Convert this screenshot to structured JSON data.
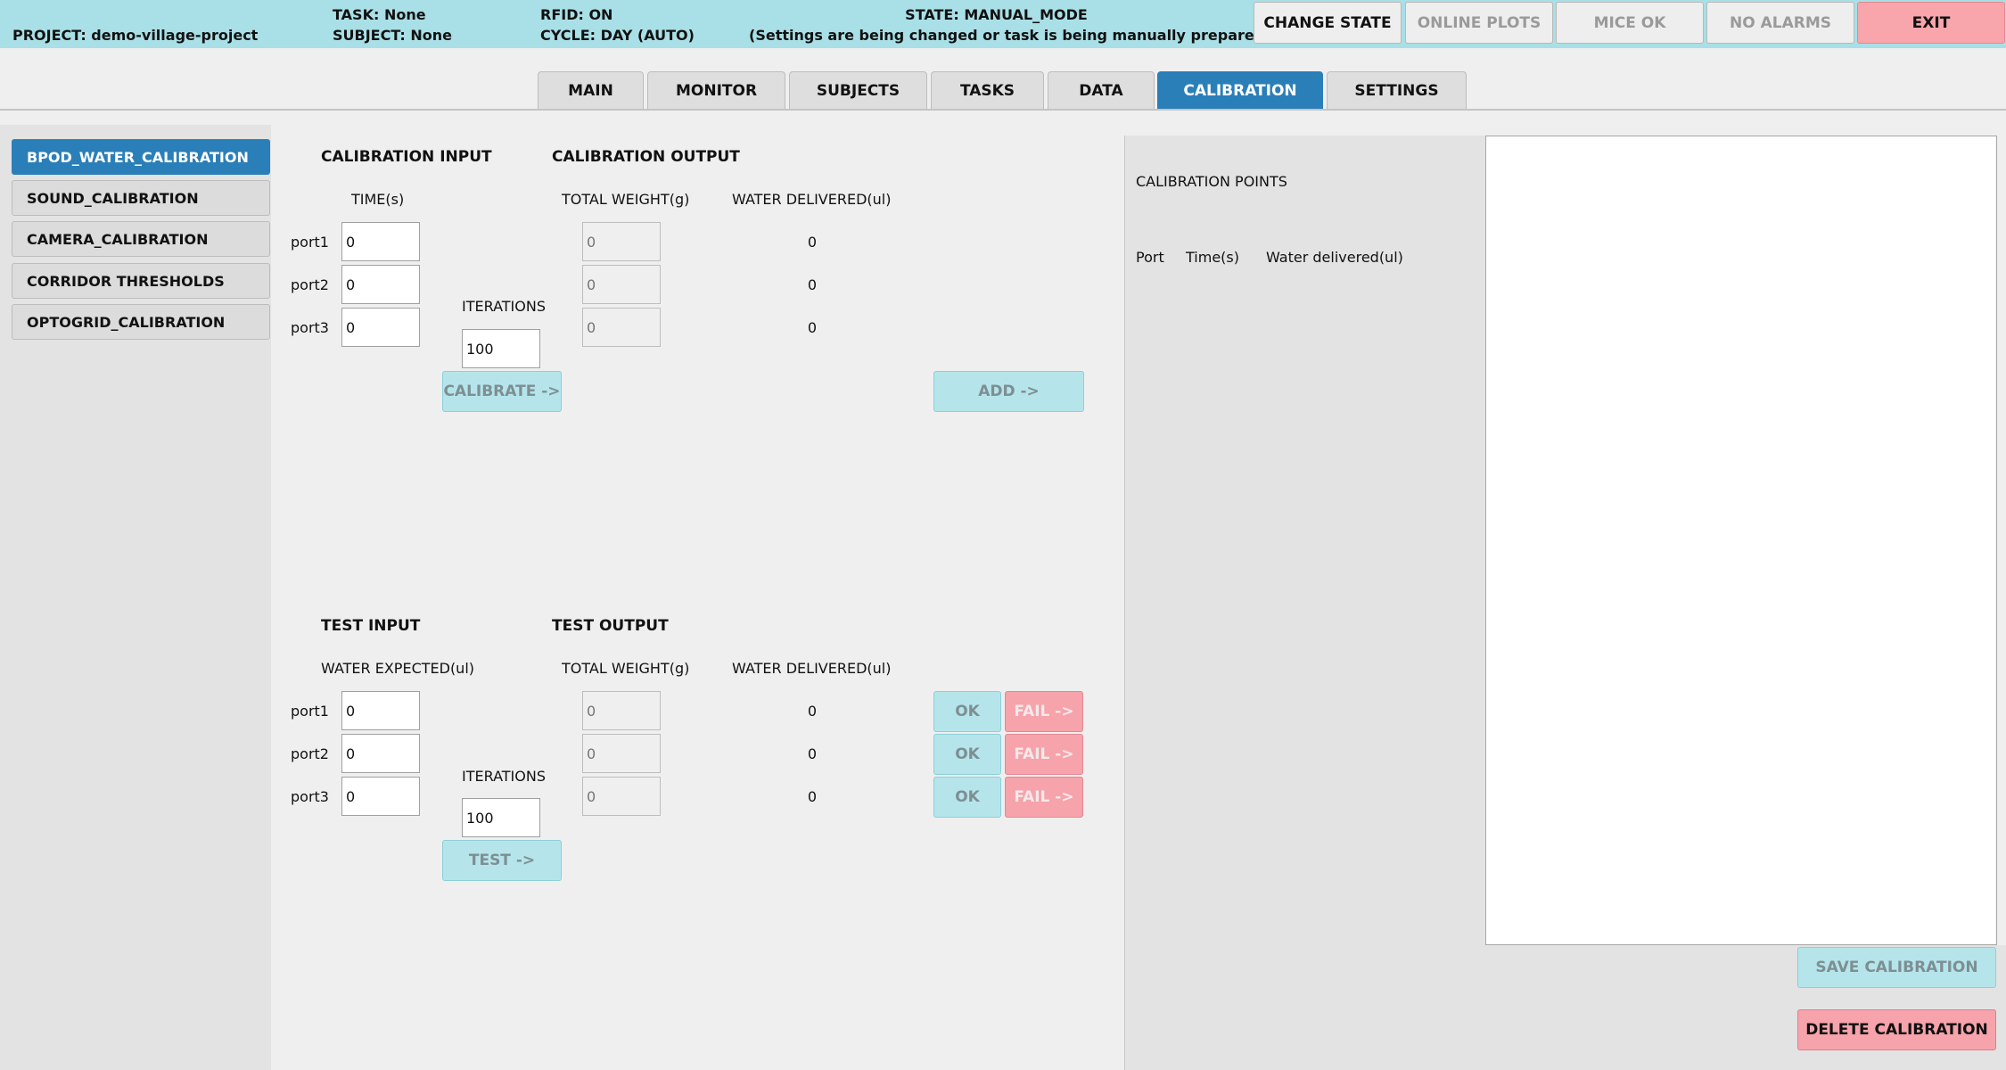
{
  "status": {
    "project": "PROJECT: demo-village-project",
    "task": "TASK: None",
    "subject": "SUBJECT: None",
    "rfid": "RFID: ON",
    "cycle": "CYCLE: DAY (AUTO)",
    "state": "STATE: MANUAL_MODE",
    "state_note": "(Settings are being changed or task is being manually prepared)"
  },
  "top_buttons": {
    "change_state": "CHANGE STATE",
    "online_plots": "ONLINE PLOTS",
    "mice_ok": "MICE OK",
    "no_alarms": "NO ALARMS",
    "exit": "EXIT"
  },
  "tabs": [
    "MAIN",
    "MONITOR",
    "SUBJECTS",
    "TASKS",
    "DATA",
    "CALIBRATION",
    "SETTINGS"
  ],
  "active_tab": "CALIBRATION",
  "sidebar": {
    "items": [
      "BPOD_WATER_CALIBRATION",
      "SOUND_CALIBRATION",
      "CAMERA_CALIBRATION",
      "CORRIDOR THRESHOLDS",
      "OPTOGRID_CALIBRATION"
    ],
    "active": "BPOD_WATER_CALIBRATION"
  },
  "calibration": {
    "input_header": "CALIBRATION INPUT",
    "output_header": "CALIBRATION OUTPUT",
    "time_label": "TIME(s)",
    "total_weight_label": "TOTAL WEIGHT(g)",
    "water_delivered_label": "WATER DELIVERED(ul)",
    "iterations_label": "ITERATIONS",
    "iterations_value": "100",
    "ports": [
      {
        "label": "port1",
        "time": "0",
        "weight_placeholder": "0",
        "delivered": "0"
      },
      {
        "label": "port2",
        "time": "0",
        "weight_placeholder": "0",
        "delivered": "0"
      },
      {
        "label": "port3",
        "time": "0",
        "weight_placeholder": "0",
        "delivered": "0"
      }
    ],
    "calibrate_button": "CALIBRATE ->",
    "add_button": "ADD ->"
  },
  "test": {
    "input_header": "TEST INPUT",
    "output_header": "TEST OUTPUT",
    "water_expected_label": "WATER EXPECTED(ul)",
    "total_weight_label": "TOTAL WEIGHT(g)",
    "water_delivered_label": "WATER DELIVERED(ul)",
    "iterations_label": "ITERATIONS",
    "iterations_value": "100",
    "ports": [
      {
        "label": "port1",
        "expected": "0",
        "weight_placeholder": "0",
        "delivered": "0"
      },
      {
        "label": "port2",
        "expected": "0",
        "weight_placeholder": "0",
        "delivered": "0"
      },
      {
        "label": "port3",
        "expected": "0",
        "weight_placeholder": "0",
        "delivered": "0"
      }
    ],
    "ok_label": "OK",
    "fail_label": "FAIL ->",
    "test_button": "TEST ->"
  },
  "points": {
    "title": "CALIBRATION POINTS",
    "columns": [
      "Port",
      "Time(s)",
      "Water delivered(ul)"
    ]
  },
  "actions": {
    "save": "SAVE CALIBRATION",
    "delete": "DELETE CALIBRATION"
  }
}
